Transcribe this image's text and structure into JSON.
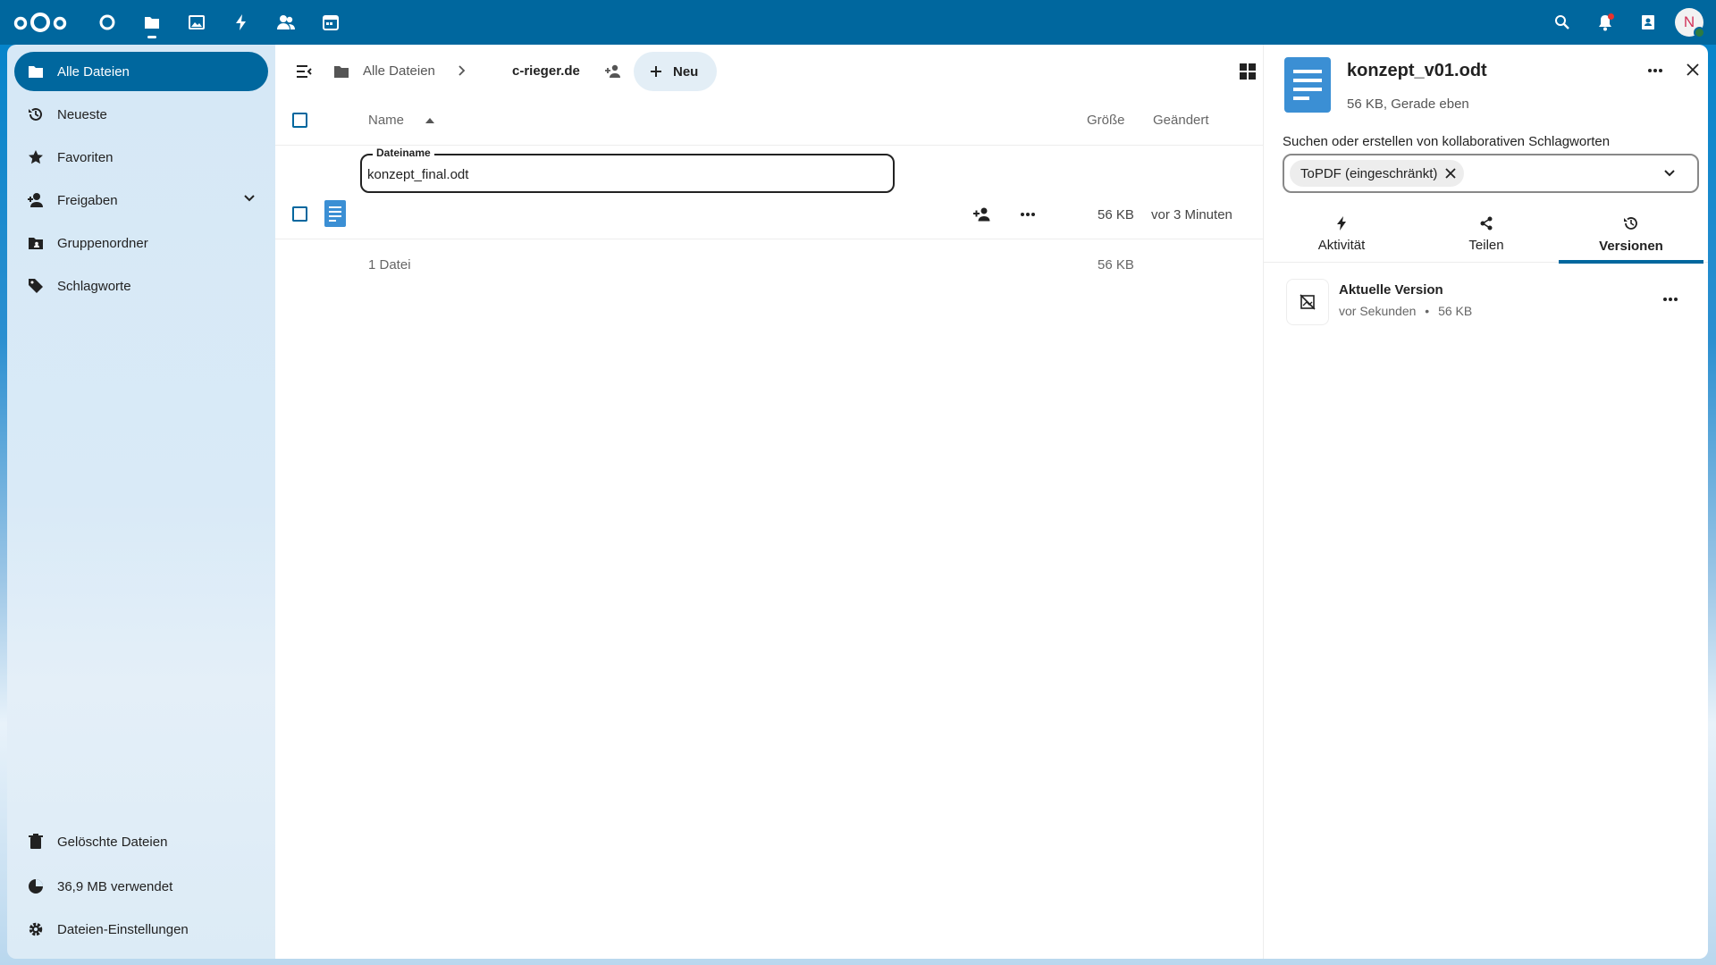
{
  "header": {
    "apps": [
      "dashboard-icon",
      "files-icon",
      "photos-icon",
      "activity-icon",
      "contacts-icon",
      "calendar-icon"
    ],
    "right": [
      "search-icon",
      "bell-icon",
      "contacts-book-icon"
    ],
    "avatar_initial": "N"
  },
  "nav": {
    "items": [
      {
        "label": "Alle Dateien",
        "icon": "folder-icon"
      },
      {
        "label": "Neueste",
        "icon": "history-icon"
      },
      {
        "label": "Favoriten",
        "icon": "star-icon"
      },
      {
        "label": "Freigaben",
        "icon": "share-user-icon"
      },
      {
        "label": "Gruppenordner",
        "icon": "group-folder-icon"
      },
      {
        "label": "Schlagworte",
        "icon": "tag-icon"
      }
    ],
    "bottom": [
      {
        "label": "Gelöschte Dateien",
        "icon": "trash-icon"
      },
      {
        "label": "36,9 MB verwendet",
        "icon": "pie-chart-icon"
      },
      {
        "label": "Dateien-Einstellungen",
        "icon": "gear-icon"
      }
    ]
  },
  "breadcrumb": {
    "root": "Alle Dateien",
    "current": "c-rieger.de",
    "new_label": "Neu"
  },
  "table": {
    "headers": {
      "name": "Name",
      "size": "Größe",
      "modified": "Geändert"
    },
    "rename": {
      "label": "Dateiname",
      "value": "konzept_final.odt"
    },
    "rows": [
      {
        "size": "56 KB",
        "modified": "vor 3 Minuten"
      }
    ],
    "summary": {
      "count": "1 Datei",
      "size": "56 KB"
    }
  },
  "sidebar": {
    "filename": "konzept_v01.odt",
    "subtitle": "56 KB, Gerade eben",
    "tag_label": "Suchen oder erstellen von kollaborativen Schlagworten",
    "tag_chip": "ToPDF (eingeschränkt)",
    "tabs": [
      {
        "label": "Aktivität",
        "icon": "activity-icon"
      },
      {
        "label": "Teilen",
        "icon": "share-icon"
      },
      {
        "label": "Versionen",
        "icon": "history-icon"
      }
    ],
    "version": {
      "title": "Aktuelle Version",
      "time": "vor Sekunden",
      "size": "56 KB"
    }
  },
  "colors": {
    "primary": "#00679e",
    "header": "#00679e",
    "chip": "#ededed"
  }
}
